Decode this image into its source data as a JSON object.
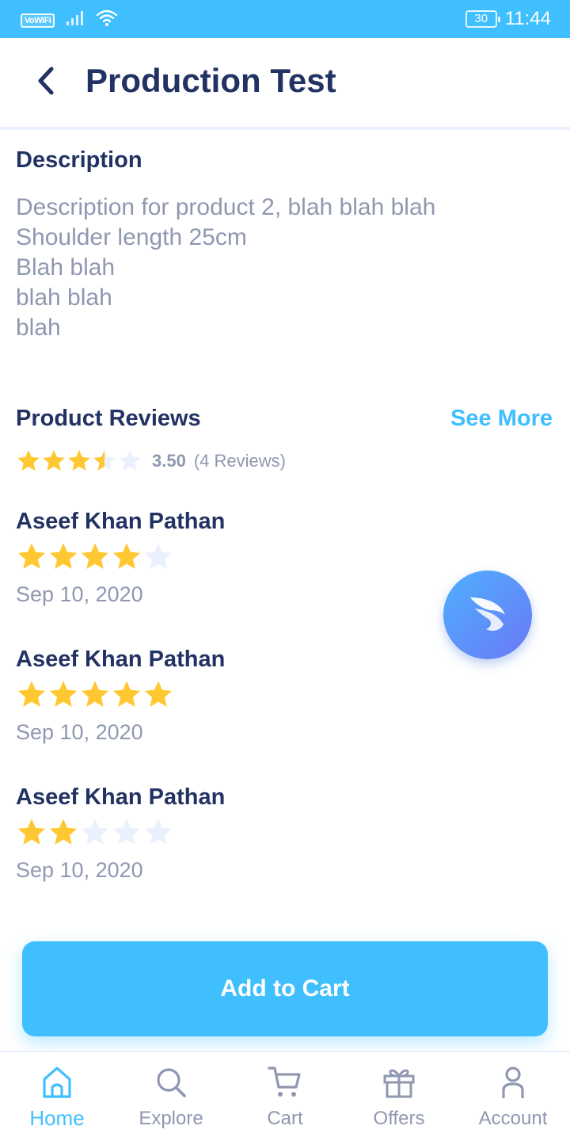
{
  "status_bar": {
    "network_badge": "VoWiFi",
    "battery": "30",
    "time": "11:44"
  },
  "header": {
    "title": "Production Test"
  },
  "description": {
    "heading": "Description",
    "lines": [
      "Description for product 2, blah blah blah",
      "Shoulder length 25cm",
      "Blah blah",
      "blah blah",
      "blah"
    ]
  },
  "reviews": {
    "heading": "Product Reviews",
    "see_more": "See More",
    "average_rating": 3.5,
    "average_label": "3.50",
    "count_label": "(4 Reviews)",
    "items": [
      {
        "name": "Aseef Khan Pathan",
        "rating": 4,
        "date": "Sep 10, 2020"
      },
      {
        "name": "Aseef Khan Pathan",
        "rating": 5,
        "date": "Sep 10, 2020"
      },
      {
        "name": "Aseef Khan Pathan",
        "rating": 2,
        "date": "Sep 10, 2020"
      }
    ]
  },
  "actions": {
    "add_to_cart": "Add to Cart"
  },
  "bottom_nav": {
    "items": [
      {
        "label": "Home",
        "icon": "home-icon",
        "active": true
      },
      {
        "label": "Explore",
        "icon": "search-icon",
        "active": false
      },
      {
        "label": "Cart",
        "icon": "cart-icon",
        "active": false
      },
      {
        "label": "Offers",
        "icon": "gift-icon",
        "active": false
      },
      {
        "label": "Account",
        "icon": "user-icon",
        "active": false
      }
    ]
  },
  "colors": {
    "primary": "#40bfff",
    "navy": "#223263",
    "grey": "#9098b1",
    "star_filled": "#ffc833",
    "star_empty": "#ebf0ff"
  }
}
